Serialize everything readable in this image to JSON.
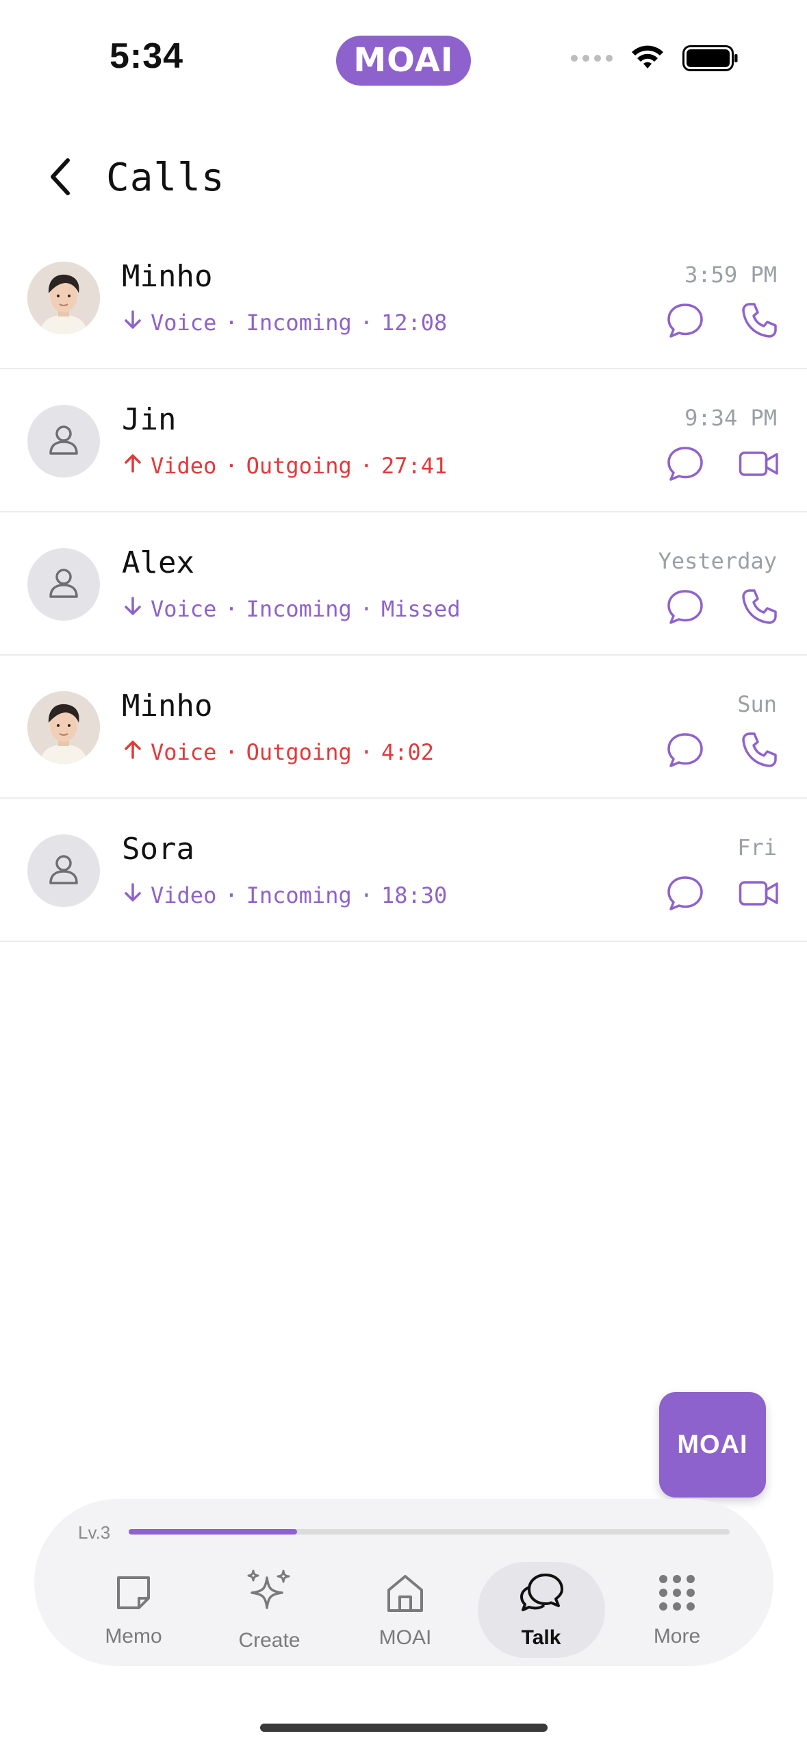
{
  "status_bar": {
    "time": "5:34",
    "app_pill": "MOAI"
  },
  "header": {
    "title": "Calls"
  },
  "calls": [
    {
      "name": "Minho",
      "type": "Voice",
      "direction": "Incoming",
      "detail": "12:08",
      "time": "3:59 PM",
      "avatar": "photo",
      "arrow": "arrow-down-icon",
      "action": "phone-icon"
    },
    {
      "name": "Jin",
      "type": "Video",
      "direction": "Outgoing",
      "detail": "27:41",
      "time": "9:34 PM",
      "avatar": "placeholder",
      "arrow": "arrow-up-icon",
      "action": "video-icon"
    },
    {
      "name": "Alex",
      "type": "Voice",
      "direction": "Incoming",
      "detail": "Missed",
      "time": "Yesterday",
      "avatar": "placeholder",
      "arrow": "arrow-down-icon",
      "action": "phone-icon"
    },
    {
      "name": "Minho",
      "type": "Voice",
      "direction": "Outgoing",
      "detail": "4:02",
      "time": "Sun",
      "avatar": "photo",
      "arrow": "arrow-up-icon",
      "action": "phone-icon"
    },
    {
      "name": "Sora",
      "type": "Video",
      "direction": "Incoming",
      "detail": "18:30",
      "time": "Fri",
      "avatar": "placeholder",
      "arrow": "arrow-down-icon",
      "action": "video-icon"
    }
  ],
  "fab": {
    "label": "MOAI"
  },
  "nav": {
    "level_label": "Lv.3",
    "level_progress": 0.28,
    "items": [
      {
        "label": "Memo",
        "icon": "memo-icon"
      },
      {
        "label": "Create",
        "icon": "sparkle-icon"
      },
      {
        "label": "MOAI",
        "icon": "home-icon"
      },
      {
        "label": "Talk",
        "icon": "chat-icon",
        "active": true
      },
      {
        "label": "More",
        "icon": "grid-icon"
      }
    ]
  },
  "colors": {
    "accent": "#8e62cc",
    "outgoing": "#e23a3a",
    "muted": "#9aa0a6"
  }
}
